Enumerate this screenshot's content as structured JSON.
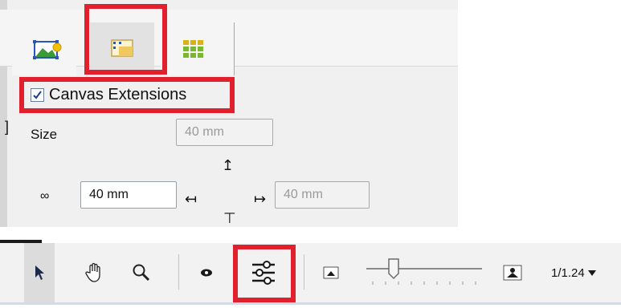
{
  "panel": {
    "tabs": [
      {
        "name": "image-tab",
        "icon": "image-icon"
      },
      {
        "name": "canvas-tab",
        "icon": "canvas-extensions-icon"
      },
      {
        "name": "grid-tab",
        "icon": "grid-icon"
      }
    ],
    "checkbox_label": "Canvas Extensions",
    "checkbox_checked": true,
    "size_label": "Size",
    "size_value": "40 mm",
    "width_value": "40 mm",
    "right_value": "40 mm"
  },
  "toolbar": {
    "tools": [
      "select-arrow-icon",
      "hand-icon",
      "zoom-icon",
      "eye-icon",
      "adjust-sliders-icon",
      "small-image-icon",
      "large-image-icon"
    ],
    "zoom_level": "1/1.24",
    "zoom_dropdown_icon": "triangle-down-icon"
  },
  "colors": {
    "highlight": "#e0202c",
    "panel_bg": "#f0f0f0",
    "toolbar_bg": "#f2f2f2",
    "accent": "#9aa6d6"
  }
}
